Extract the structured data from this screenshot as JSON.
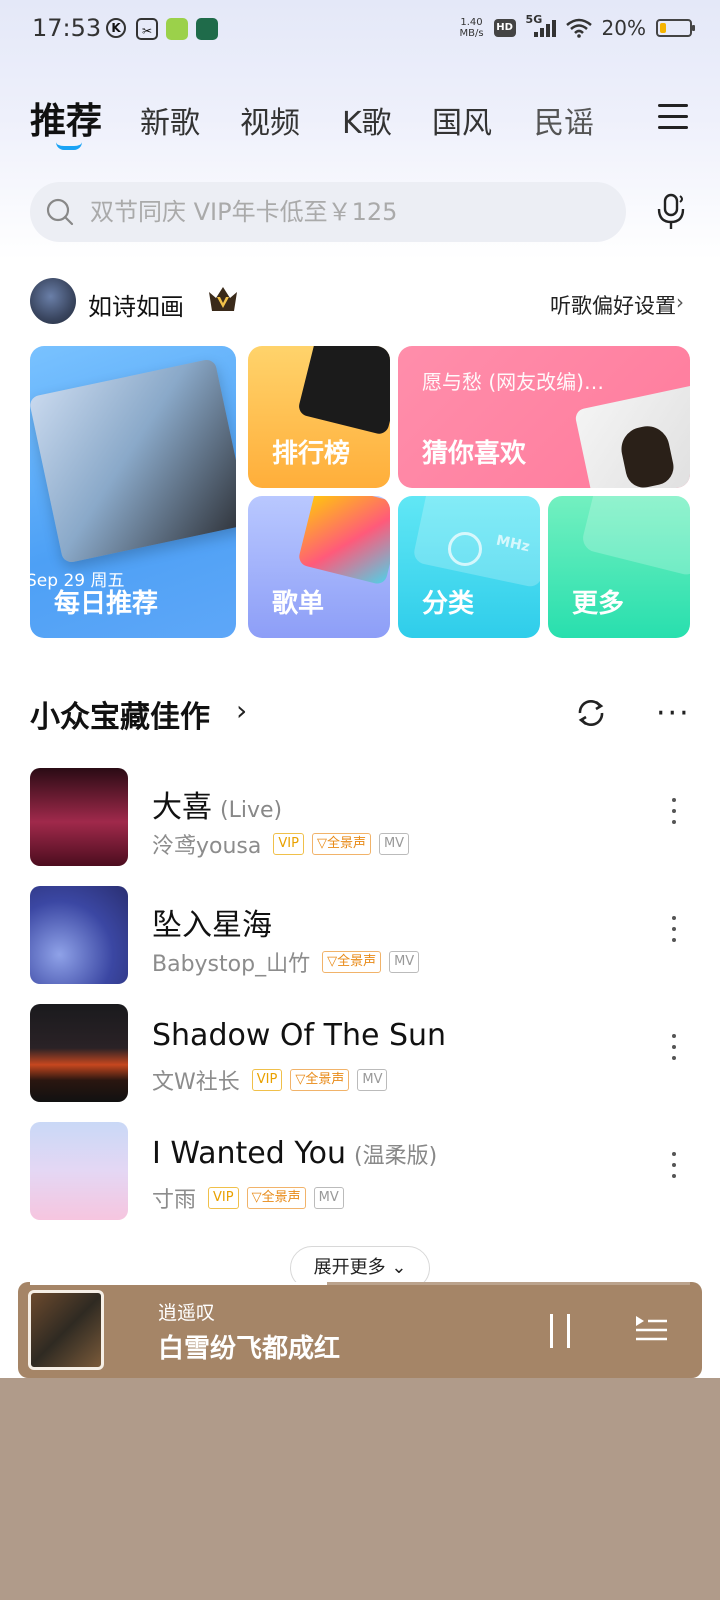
{
  "status_bar": {
    "time": "17:53",
    "net_speed_value": "1.40",
    "net_speed_unit": "MB/s",
    "hd": "HD",
    "network": "5G",
    "battery_pct": "20%",
    "battery_level": 0.2
  },
  "tabs": [
    {
      "label": "推荐",
      "active": true
    },
    {
      "label": "新歌"
    },
    {
      "label": "视频"
    },
    {
      "label": "K歌"
    },
    {
      "label": "国风"
    },
    {
      "label": "民谣"
    }
  ],
  "search": {
    "placeholder": "双节同庆 VIP年卡低至￥125"
  },
  "user": {
    "name": "如诗如画",
    "pref_link": "听歌偏好设置"
  },
  "cards": {
    "daily": {
      "date": "Sep 29 周五",
      "label": "每日推荐"
    },
    "rank": {
      "label": "排行榜"
    },
    "guess": {
      "subtitle": "愿与愁 (网友改编)…",
      "label": "猜你喜欢"
    },
    "playlist": {
      "label": "歌单"
    },
    "category": {
      "label": "分类",
      "art_text": "MHz"
    },
    "more": {
      "label": "更多"
    }
  },
  "section": {
    "title": "小众宝藏佳作"
  },
  "songs": [
    {
      "title": "大喜",
      "tag": "(Live)",
      "artist": "泠鸢yousa",
      "vip": "VIP",
      "quality": "全景声",
      "mv": "MV"
    },
    {
      "title": "坠入星海",
      "tag": "",
      "artist": "Babystop_山竹",
      "quality": "全景声",
      "mv": "MV"
    },
    {
      "title": "Shadow Of The Sun",
      "tag": "",
      "artist": "文W社长",
      "vip": "VIP",
      "quality": "全景声",
      "mv": "MV"
    },
    {
      "title": "I Wanted You",
      "tag": "(温柔版)",
      "artist": "寸雨",
      "vip": "VIP",
      "quality": "全景声",
      "mv": "MV"
    }
  ],
  "expand_label": "展开更多",
  "player": {
    "artist": "逍遥叹",
    "title": "白雪纷飞都成红",
    "progress": 0.45
  },
  "colors": {
    "accent": "#1aa3f5",
    "vip": "#e9a100",
    "player_bg": "#a58567"
  }
}
